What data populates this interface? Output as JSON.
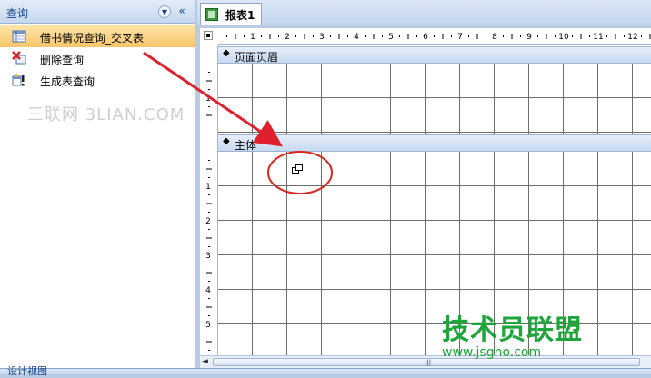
{
  "nav": {
    "title": "查询",
    "items": [
      {
        "label": "借书情况查询_交叉表",
        "icon": "crosstab-query-icon",
        "selected": true
      },
      {
        "label": "删除查询",
        "icon": "delete-query-icon",
        "selected": false
      },
      {
        "label": "生成表查询",
        "icon": "make-table-query-icon",
        "selected": false
      }
    ],
    "watermark": "三联网 3LIAN.COM"
  },
  "document": {
    "tab_label": "报表1",
    "sections": {
      "page_header": "页面页眉",
      "detail": "主体"
    },
    "hruler_numbers": [
      "1",
      "2",
      "3",
      "4",
      "5",
      "6",
      "7",
      "8",
      "9",
      "10",
      "11",
      "12"
    ],
    "vruler_header_numbers": [
      "1"
    ],
    "vruler_detail_numbers": [
      "1",
      "2",
      "3",
      "4",
      "5"
    ]
  },
  "status": {
    "text": "设计视图"
  },
  "watermark_brand": "技术员联盟",
  "watermark_url": "www.jsgho.com",
  "colors": {
    "accent": "#15428b",
    "selection": "#f9c66a",
    "annotation_red": "#e0202a",
    "grid": "#6e6e6e",
    "brand_green": "#1fa53a"
  }
}
